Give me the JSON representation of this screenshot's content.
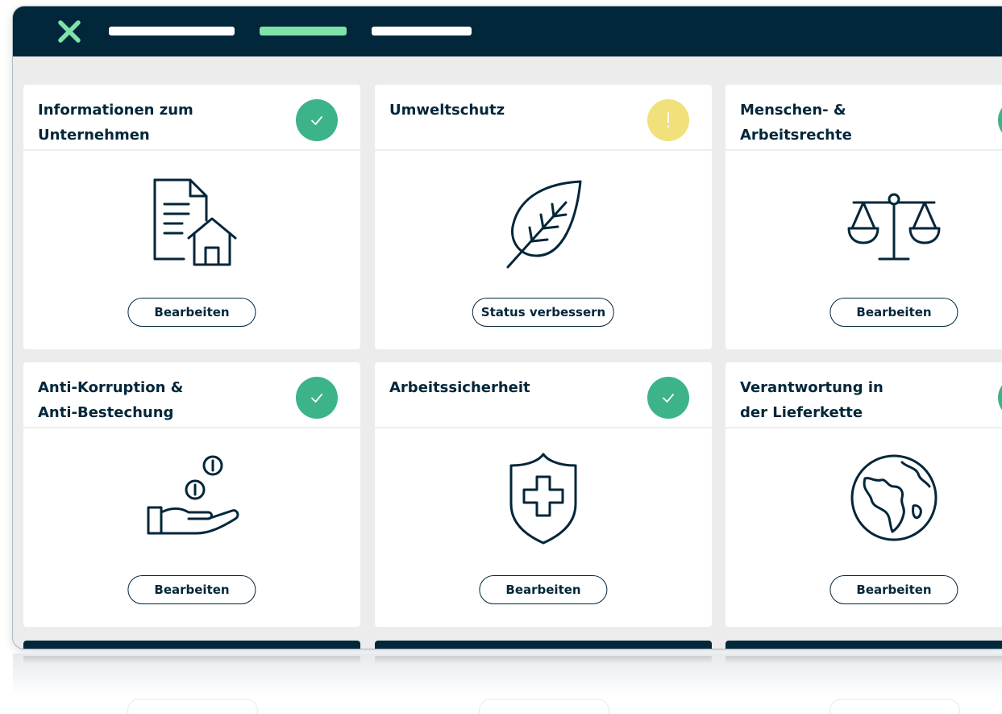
{
  "colors": {
    "navy": "#02263a",
    "accent": "#7fe3a9",
    "status_ok": "#3db38a",
    "status_warn": "#f1e17a"
  },
  "header": {
    "logo_icon": "x-logo-icon",
    "nav_items": [
      "nav-item-1",
      "nav-item-2-active",
      "nav-item-3"
    ]
  },
  "cards": [
    {
      "title": "Informationen zum\nUnternehmen",
      "status": "ok",
      "status_icon": "check-icon",
      "icon": "document-house-icon",
      "button": "Bearbeiten"
    },
    {
      "title": "Umweltschutz",
      "status": "warning",
      "status_icon": "exclamation-icon",
      "icon": "leaf-icon",
      "button": "Status verbessern"
    },
    {
      "title": "Menschen- &\nArbeitsrechte",
      "status": "ok",
      "status_icon": "check-icon",
      "icon": "scales-icon",
      "button": "Bearbeiten"
    },
    {
      "title": "Anti-Korruption &\nAnti-Bestechung",
      "status": "ok",
      "status_icon": "check-icon",
      "icon": "hand-coins-icon",
      "button": "Bearbeiten"
    },
    {
      "title": "Arbeitssicherheit",
      "status": "ok",
      "status_icon": "check-icon",
      "icon": "shield-cross-icon",
      "button": "Bearbeiten"
    },
    {
      "title": "Verantwortung in\nder Lieferkette",
      "status": "ok",
      "status_icon": "check-icon",
      "icon": "globe-icon",
      "button": "Bearbeiten"
    }
  ]
}
